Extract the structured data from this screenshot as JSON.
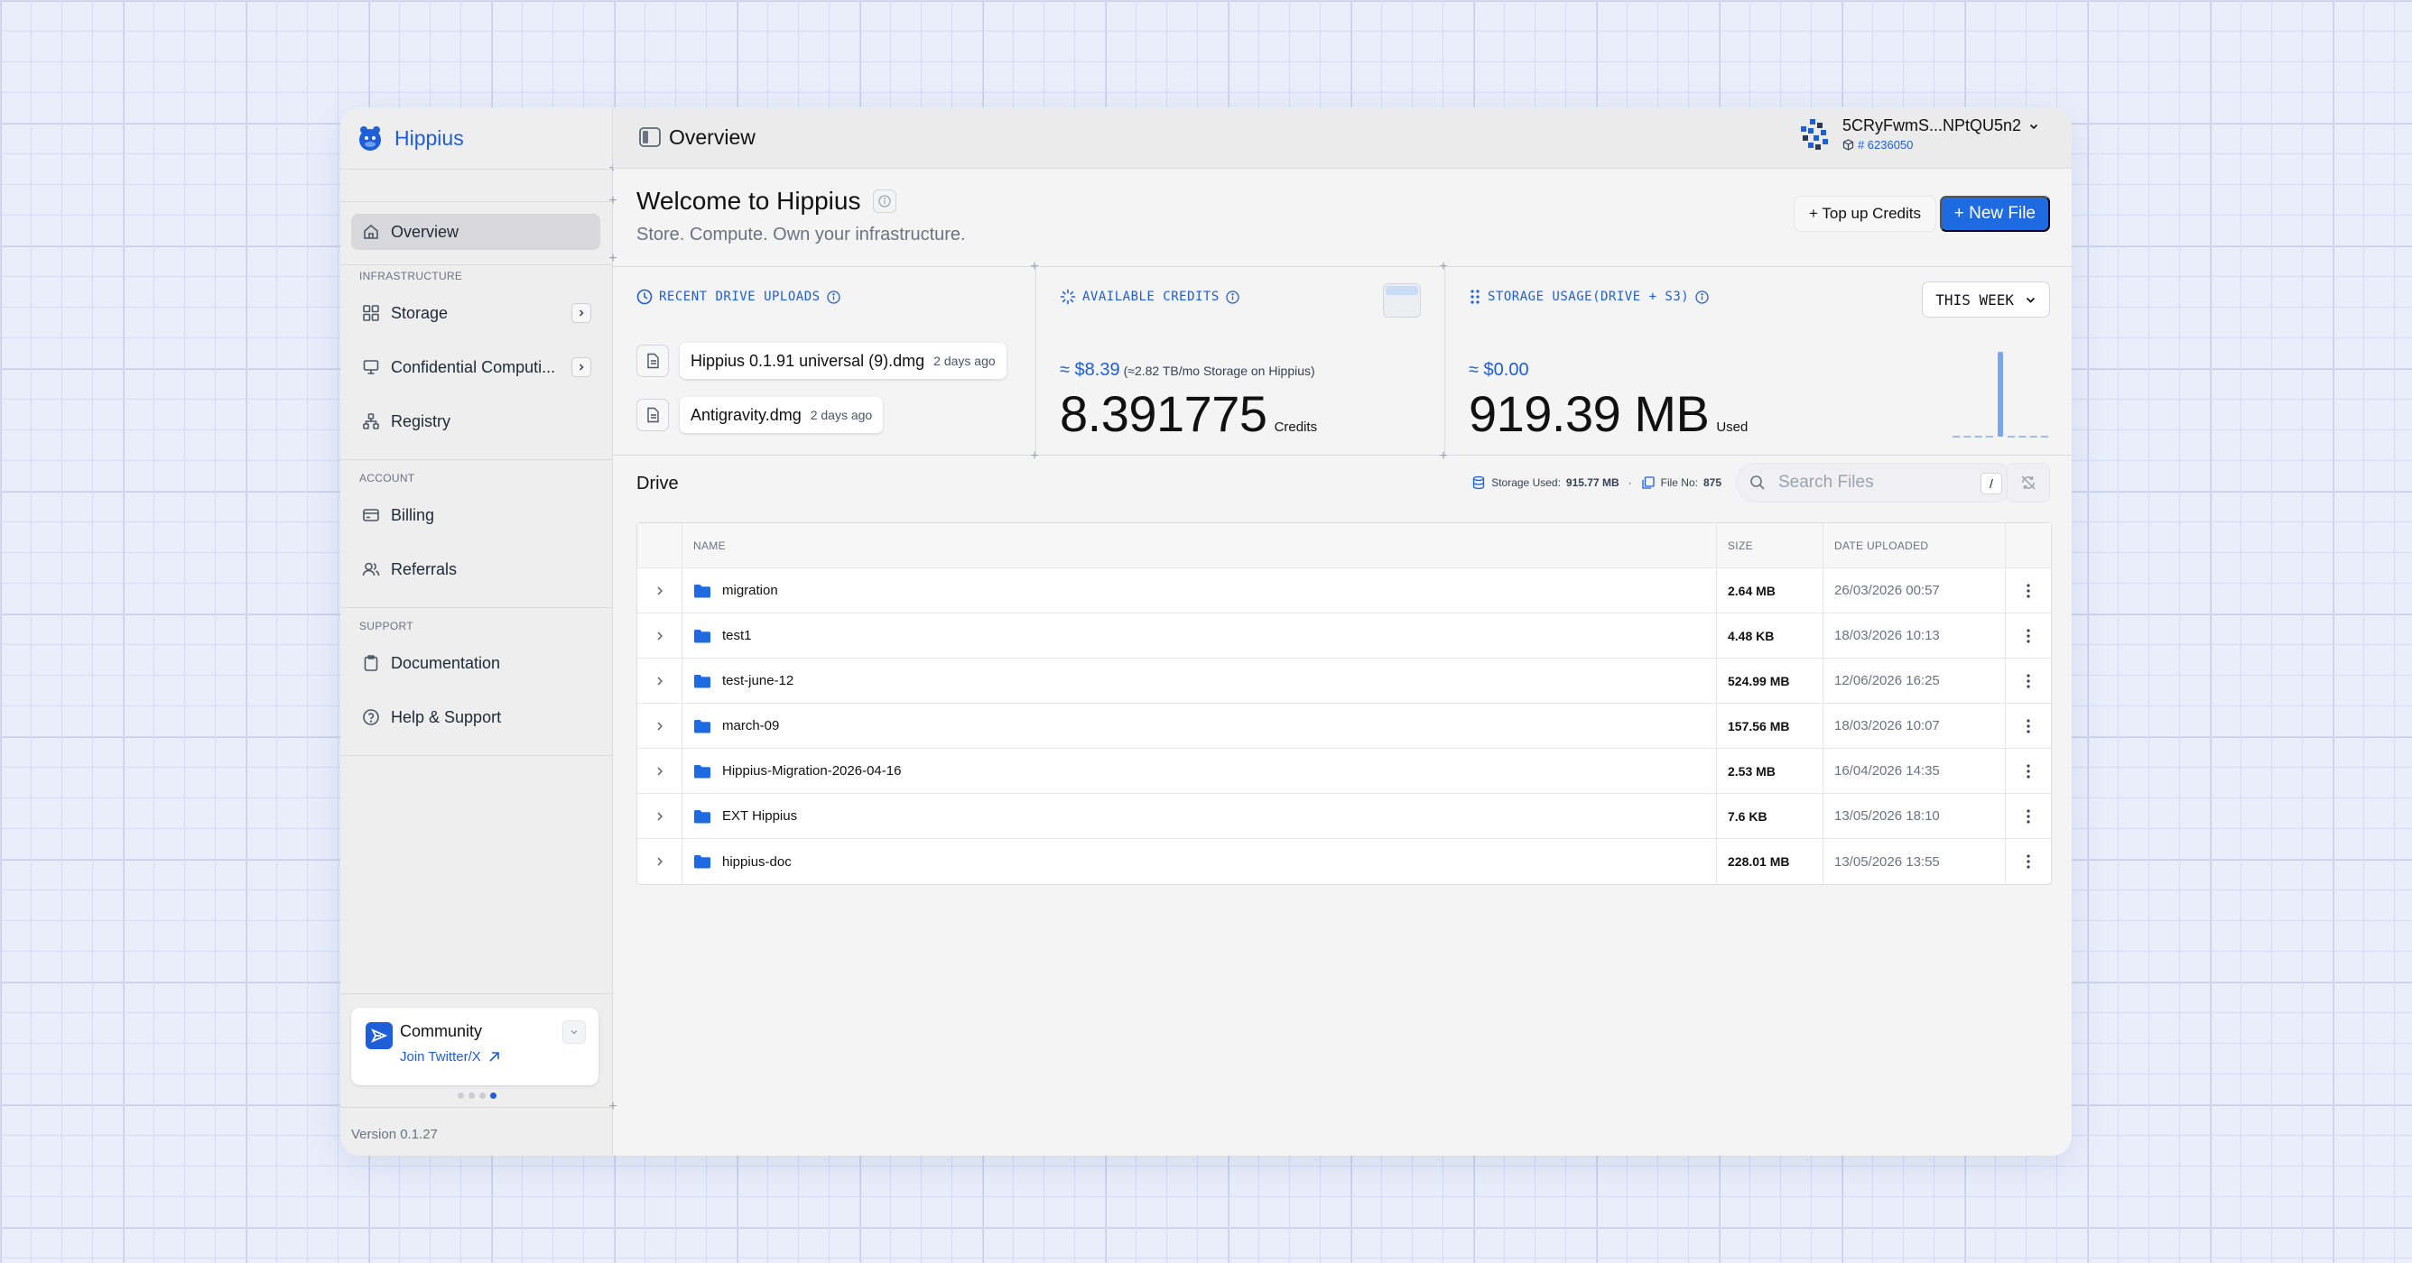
{
  "brand": {
    "name": "Hippius"
  },
  "header": {
    "page_title": "Overview",
    "user": {
      "address": "5CRyFwmS...NPtQU5n2",
      "block": "# 6236050"
    }
  },
  "sidebar": {
    "overview": "Overview",
    "infrastructure_label": "INFRASTRUCTURE",
    "storage": "Storage",
    "confidential": "Confidential Computi...",
    "registry": "Registry",
    "account_label": "ACCOUNT",
    "billing": "Billing",
    "referrals": "Referrals",
    "support_label": "SUPPORT",
    "documentation": "Documentation",
    "help": "Help & Support",
    "community": {
      "title": "Community",
      "link": "Join Twitter/X"
    },
    "carousel": {
      "count": 4,
      "active": 4
    },
    "version": "Version 0.1.27"
  },
  "welcome": {
    "title": "Welcome to Hippius",
    "subtitle": "Store. Compute. Own your infrastructure.",
    "topup_label": "+ Top up Credits",
    "new_file_label": "+ New File"
  },
  "cards": {
    "uploads": {
      "title": "RECENT DRIVE UPLOADS",
      "items": [
        {
          "name": "Hippius 0.1.91 universal (9).dmg",
          "ago": "2 days ago"
        },
        {
          "name": "Antigravity.dmg",
          "ago": "2 days ago"
        }
      ]
    },
    "credits": {
      "title": "AVAILABLE CREDITS",
      "usd": "≈ $8.39",
      "note": "(≈2.82 TB/mo Storage on Hippius)",
      "value": "8.391775",
      "unit": "Credits"
    },
    "usage": {
      "title": "STORAGE USAGE(DRIVE + S3)",
      "usd": "≈ $0.00",
      "value": "919.39 MB",
      "unit": "Used",
      "range_label": "THIS WEEK",
      "bars": [
        0,
        0,
        0,
        0,
        1,
        0,
        0,
        0,
        0
      ]
    }
  },
  "drive": {
    "title": "Drive",
    "storage_used_label": "Storage Used:",
    "storage_used_value": "915.77 MB",
    "bullet": "·",
    "file_no_label": "File No:",
    "file_no_value": "875",
    "search_placeholder": "Search Files",
    "search_shortcut": "/",
    "columns": {
      "name": "NAME",
      "size": "SIZE",
      "date": "DATE UPLOADED"
    },
    "rows": [
      {
        "name": "migration",
        "size": "2.64 MB",
        "date": "26/03/2026 00:57"
      },
      {
        "name": "test1",
        "size": "4.48 KB",
        "date": "18/03/2026 10:13"
      },
      {
        "name": "test-june-12",
        "size": "524.99 MB",
        "date": "12/06/2026 16:25"
      },
      {
        "name": "march-09",
        "size": "157.56 MB",
        "date": "18/03/2026 10:07"
      },
      {
        "name": "Hippius-Migration-2026-04-16",
        "size": "2.53 MB",
        "date": "16/04/2026 14:35"
      },
      {
        "name": "EXT Hippius",
        "size": "7.6 KB",
        "date": "13/05/2026 18:10"
      },
      {
        "name": "hippius-doc",
        "size": "228.01 MB",
        "date": "13/05/2026 13:55"
      }
    ]
  },
  "colors": {
    "accent": "#1e6ae0",
    "brand": "#1e5ed8"
  }
}
